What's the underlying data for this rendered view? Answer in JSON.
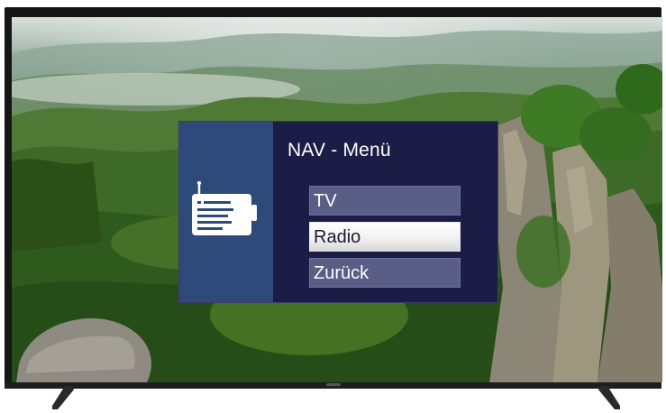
{
  "menu": {
    "title": "NAV - Menü",
    "items": [
      {
        "label": "TV",
        "selected": false
      },
      {
        "label": "Radio",
        "selected": true
      },
      {
        "label": "Zurück",
        "selected": false
      }
    ],
    "icon": "radio-icon"
  },
  "colors": {
    "menu_background": "#1c1d47",
    "sidebar_background": "#2e4a7a",
    "item_background": "#5a5e86",
    "item_selected_background": "#ffffff",
    "text": "#ffffff"
  }
}
